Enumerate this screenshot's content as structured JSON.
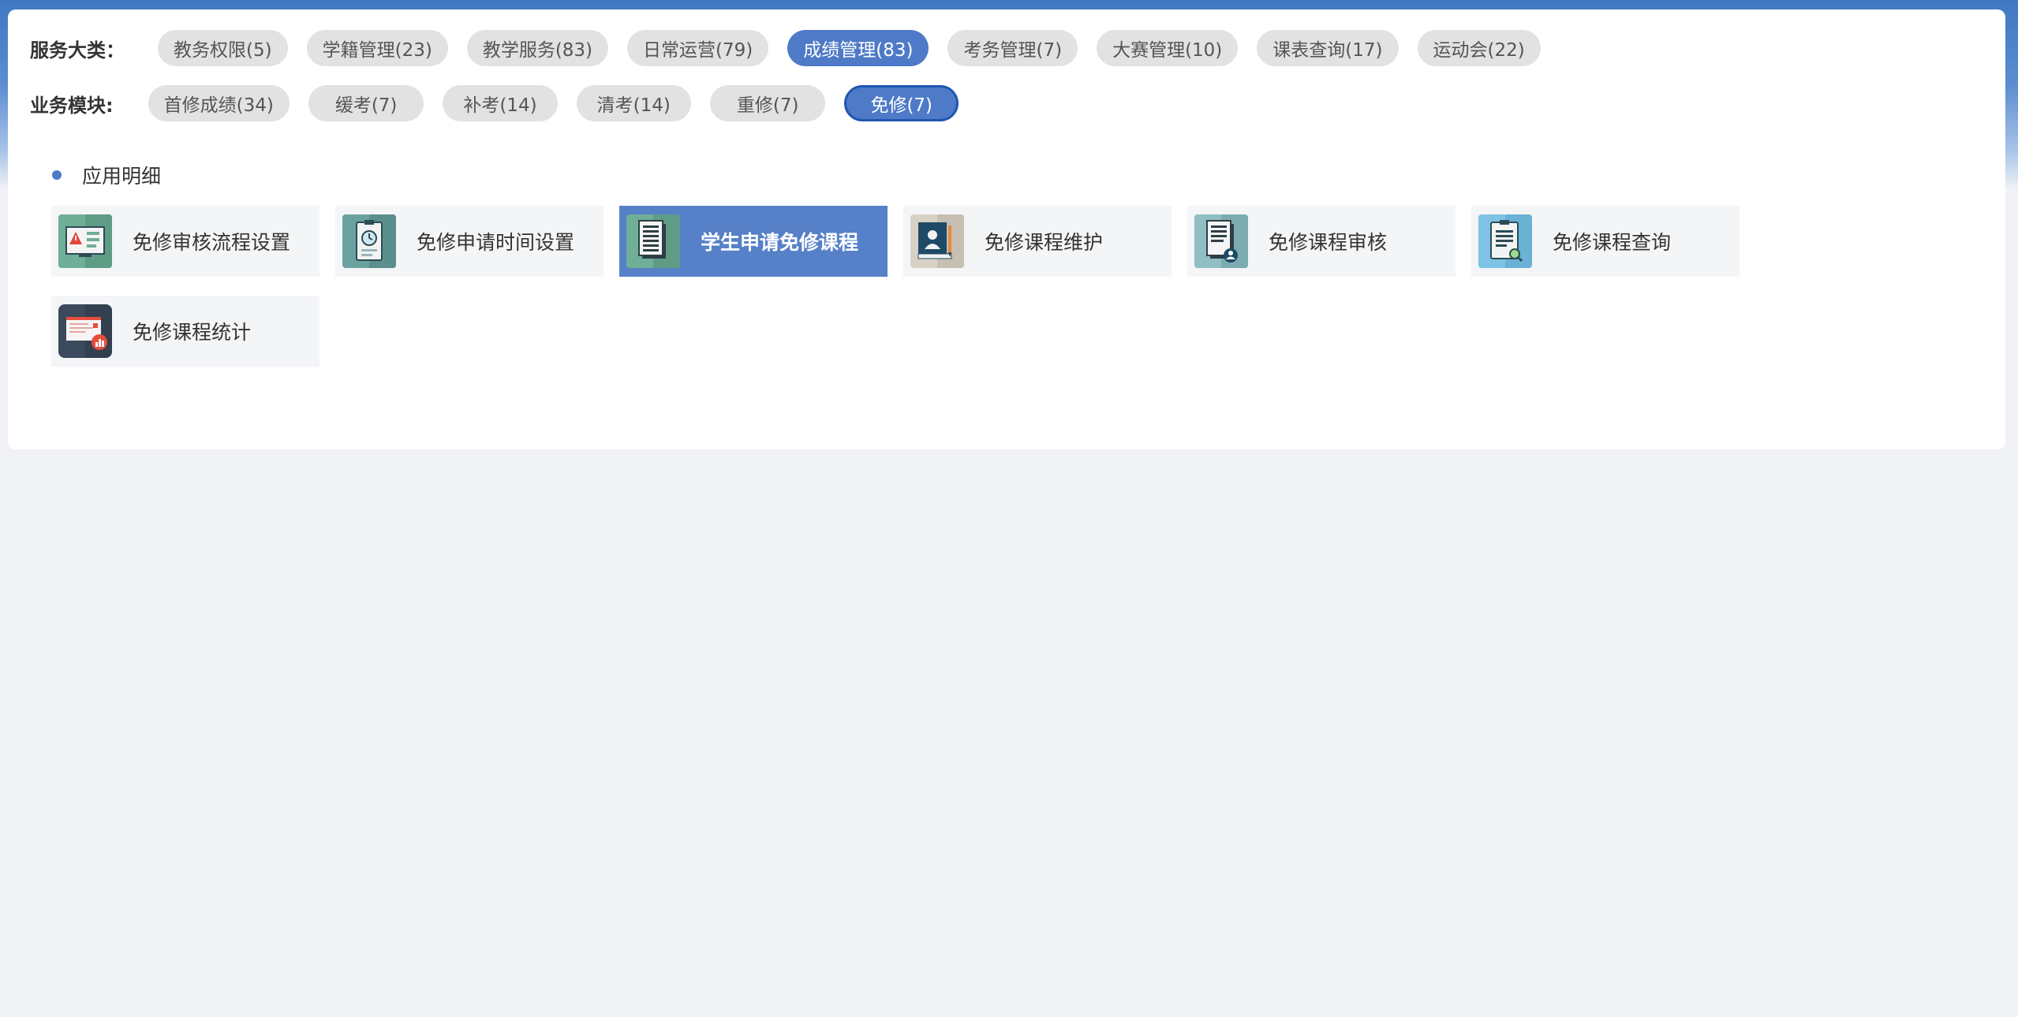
{
  "service_category": {
    "label": "服务大类：",
    "items": [
      {
        "label": "教务权限(5)"
      },
      {
        "label": "学籍管理(23)"
      },
      {
        "label": "教学服务(83)"
      },
      {
        "label": "日常运营(79)"
      },
      {
        "label": "成绩管理(83)",
        "active": true
      },
      {
        "label": "考务管理(7)"
      },
      {
        "label": "大赛管理(10)"
      },
      {
        "label": "课表查询(17)"
      },
      {
        "label": "运动会(22)"
      }
    ]
  },
  "business_module": {
    "label": "业务模块:",
    "items": [
      {
        "label": "首修成绩(34)"
      },
      {
        "label": "缓考(7)"
      },
      {
        "label": "补考(14)"
      },
      {
        "label": "清考(14)"
      },
      {
        "label": "重修(7)"
      },
      {
        "label": "免修(7)",
        "active": true
      }
    ]
  },
  "section": {
    "title": "应用明细"
  },
  "apps": [
    {
      "label": "免修审核流程设置",
      "icon": "workflow-settings-icon"
    },
    {
      "label": "免修申请时间设置",
      "icon": "clipboard-clock-icon"
    },
    {
      "label": "学生申请免修课程",
      "icon": "document-list-icon",
      "active": true
    },
    {
      "label": "免修课程维护",
      "icon": "id-card-maintenance-icon"
    },
    {
      "label": "免修课程审核",
      "icon": "document-user-icon"
    },
    {
      "label": "免修课程查询",
      "icon": "clipboard-search-icon"
    },
    {
      "label": "免修课程统计",
      "icon": "statistics-report-icon"
    }
  ],
  "colors": {
    "accent": "#4e7ac7",
    "header": "#3f78c2",
    "tile_bg": "#f4f5f7"
  }
}
